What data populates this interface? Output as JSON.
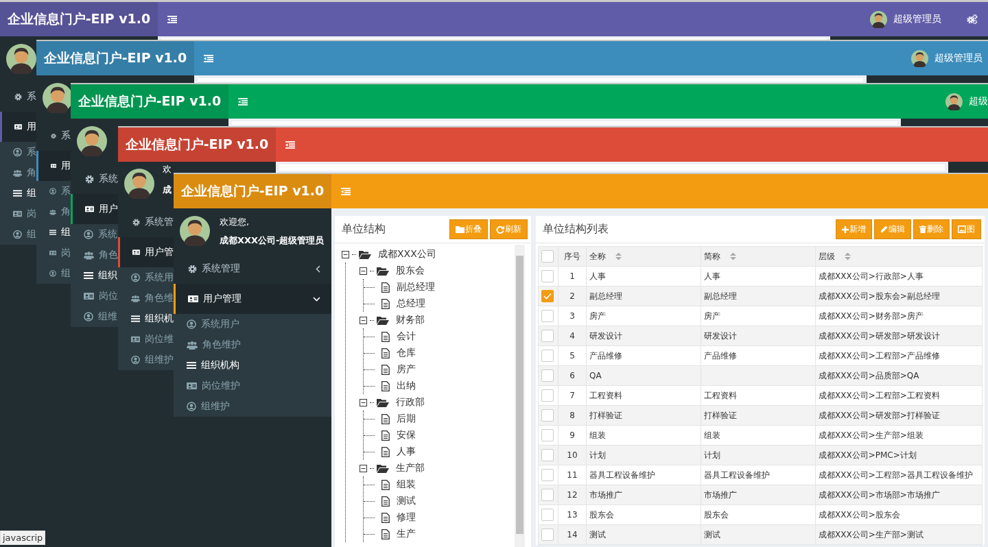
{
  "layers": [
    {
      "color": "#605ca8",
      "logo": "企业信息门户-EIP v1.0",
      "user": {
        "name": "超级管理员"
      },
      "settings_icon": true,
      "sidebar": {
        "menu": [
          {
            "label": "系",
            "expanded": false
          },
          {
            "label": "用",
            "expanded": true,
            "children": [
              {
                "label": "系",
                "selected": false
              },
              {
                "label": "角",
                "selected": false
              },
              {
                "label": "组",
                "selected": true
              },
              {
                "label": "岗",
                "selected": false
              },
              {
                "label": "组",
                "selected": false
              }
            ]
          }
        ]
      }
    },
    {
      "color": "#3c8dbc",
      "logo": "企业信息门户-EIP v1.0",
      "user": {
        "name": "超级管理员"
      },
      "sidebar": {
        "menu": [
          {
            "label": "系",
            "expanded": false
          },
          {
            "label": "用",
            "expanded": true,
            "children": [
              {
                "label": "系",
                "selected": false
              },
              {
                "label": "角",
                "selected": false
              },
              {
                "label": "组",
                "selected": true
              },
              {
                "label": "岗",
                "selected": false
              },
              {
                "label": "组",
                "selected": false
              }
            ]
          }
        ]
      }
    },
    {
      "color": "#00a65a",
      "logo": "企业信息门户-EIP v1.0",
      "user": {
        "name": "超级"
      },
      "sidebar": {
        "menu": [
          {
            "label": "系统",
            "expanded": false
          },
          {
            "label": "用户",
            "expanded": true,
            "children": [
              {
                "label": "系统",
                "selected": false
              },
              {
                "label": "角色",
                "selected": false
              },
              {
                "label": "组织",
                "selected": true
              },
              {
                "label": "岗位",
                "selected": false
              },
              {
                "label": "组维",
                "selected": false
              }
            ]
          }
        ]
      }
    },
    {
      "color": "#dd4b39",
      "logo": "企业信息门户-EIP v1.0",
      "sidebar": {
        "welcome": {
          "greeting": "欢",
          "account": "成"
        },
        "menu": [
          {
            "label": "系统管",
            "expanded": false
          },
          {
            "label": "用户管",
            "expanded": true,
            "children": [
              {
                "label": "系统用",
                "selected": false
              },
              {
                "label": "角色维",
                "selected": false
              },
              {
                "label": "组织机",
                "selected": true
              },
              {
                "label": "岗位维",
                "selected": false
              },
              {
                "label": "组维护",
                "selected": false
              }
            ]
          }
        ]
      }
    },
    {
      "color": "#f39c12",
      "logo": "企业信息门户-EIP v1.0",
      "sidebar": {
        "welcome": {
          "greeting": "欢迎您,",
          "account": "成都XXX公司-超级管理员"
        },
        "show_chevrons": true,
        "menu": [
          {
            "label": "系统管理",
            "expanded": false
          },
          {
            "label": "用户管理",
            "expanded": true,
            "children": [
              {
                "label": "系统用户",
                "selected": false
              },
              {
                "label": "角色维护",
                "selected": false
              },
              {
                "label": "组织机构",
                "selected": true
              },
              {
                "label": "岗位维护",
                "selected": false
              },
              {
                "label": "组维护",
                "selected": false
              }
            ]
          }
        ]
      },
      "content": {
        "tree_panel": {
          "title": "单位结构",
          "buttons": [
            {
              "label": "折叠"
            },
            {
              "label": "刷新"
            }
          ],
          "tree": [
            {
              "label": "成都XXX公司",
              "expanded": true,
              "children": [
                {
                  "label": "股东会",
                  "expanded": true,
                  "children": [
                    {
                      "label": "副总经理"
                    },
                    {
                      "label": "总经理"
                    }
                  ]
                },
                {
                  "label": "财务部",
                  "expanded": true,
                  "children": [
                    {
                      "label": "会计"
                    },
                    {
                      "label": "仓库"
                    },
                    {
                      "label": "房产"
                    },
                    {
                      "label": "出纳"
                    }
                  ]
                },
                {
                  "label": "行政部",
                  "expanded": true,
                  "children": [
                    {
                      "label": "后期"
                    },
                    {
                      "label": "安保"
                    },
                    {
                      "label": "人事"
                    }
                  ]
                },
                {
                  "label": "生产部",
                  "expanded": true,
                  "children": [
                    {
                      "label": "组装"
                    },
                    {
                      "label": "测试"
                    },
                    {
                      "label": "修理"
                    },
                    {
                      "label": "生产"
                    }
                  ]
                }
              ]
            }
          ]
        },
        "list_panel": {
          "title": "单位结构列表",
          "buttons": [
            {
              "label": "新增"
            },
            {
              "label": "编辑"
            },
            {
              "label": "删除"
            },
            {
              "label": "图"
            }
          ],
          "table": {
            "all_checked": false,
            "columns": [
              {
                "label": "序号",
                "sortable": false
              },
              {
                "label": "全称",
                "sortable": true
              },
              {
                "label": "简称",
                "sortable": true
              },
              {
                "label": "层级",
                "sortable": true
              }
            ],
            "rows": [
              {
                "checked": false,
                "no": "1",
                "full_name": "人事",
                "short_name": "人事",
                "path": "成都XXX公司>行政部>人事"
              },
              {
                "checked": true,
                "no": "2",
                "full_name": "副总经理",
                "short_name": "副总经理",
                "path": "成都XXX公司>股东会>副总经理"
              },
              {
                "checked": false,
                "no": "3",
                "full_name": "房产",
                "short_name": "房产",
                "path": "成都XXX公司>财务部>房产"
              },
              {
                "checked": false,
                "no": "4",
                "full_name": "研发设计",
                "short_name": "研发设计",
                "path": "成都XXX公司>研发部>研发设计"
              },
              {
                "checked": false,
                "no": "5",
                "full_name": "产品维修",
                "short_name": "产品维修",
                "path": "成都XXX公司>工程部>产品维修"
              },
              {
                "checked": false,
                "no": "6",
                "full_name": "QA",
                "path": "成都XXX公司>品质部>QA"
              },
              {
                "checked": false,
                "no": "7",
                "full_name": "工程资料",
                "short_name": "工程资料",
                "path": "成都XXX公司>工程部>工程资料"
              },
              {
                "checked": false,
                "no": "8",
                "full_name": "打样验证",
                "short_name": "打样验证",
                "path": "成都XXX公司>研发部>打样验证"
              },
              {
                "checked": false,
                "no": "9",
                "full_name": "组装",
                "short_name": "组装",
                "path": "成都XXX公司>生产部>组装"
              },
              {
                "checked": false,
                "no": "10",
                "full_name": "计划",
                "short_name": "计划",
                "path": "成都XXX公司>PMC>计划"
              },
              {
                "checked": false,
                "no": "11",
                "full_name": "器具工程设备维护",
                "short_name": "器具工程设备维护",
                "path": "成都XXX公司>工程部>器具工程设备维护"
              },
              {
                "checked": false,
                "no": "12",
                "full_name": "市场推广",
                "short_name": "市场推广",
                "path": "成都XXX公司>市场部>市场推广"
              },
              {
                "checked": false,
                "no": "13",
                "full_name": "股东会",
                "short_name": "股东会",
                "path": "成都XXX公司>股东会"
              },
              {
                "checked": false,
                "no": "14",
                "full_name": "测试",
                "short_name": "测试",
                "path": "成都XXX公司>生产部>测试"
              }
            ]
          }
        }
      }
    }
  ],
  "browser_status": "javascrip"
}
